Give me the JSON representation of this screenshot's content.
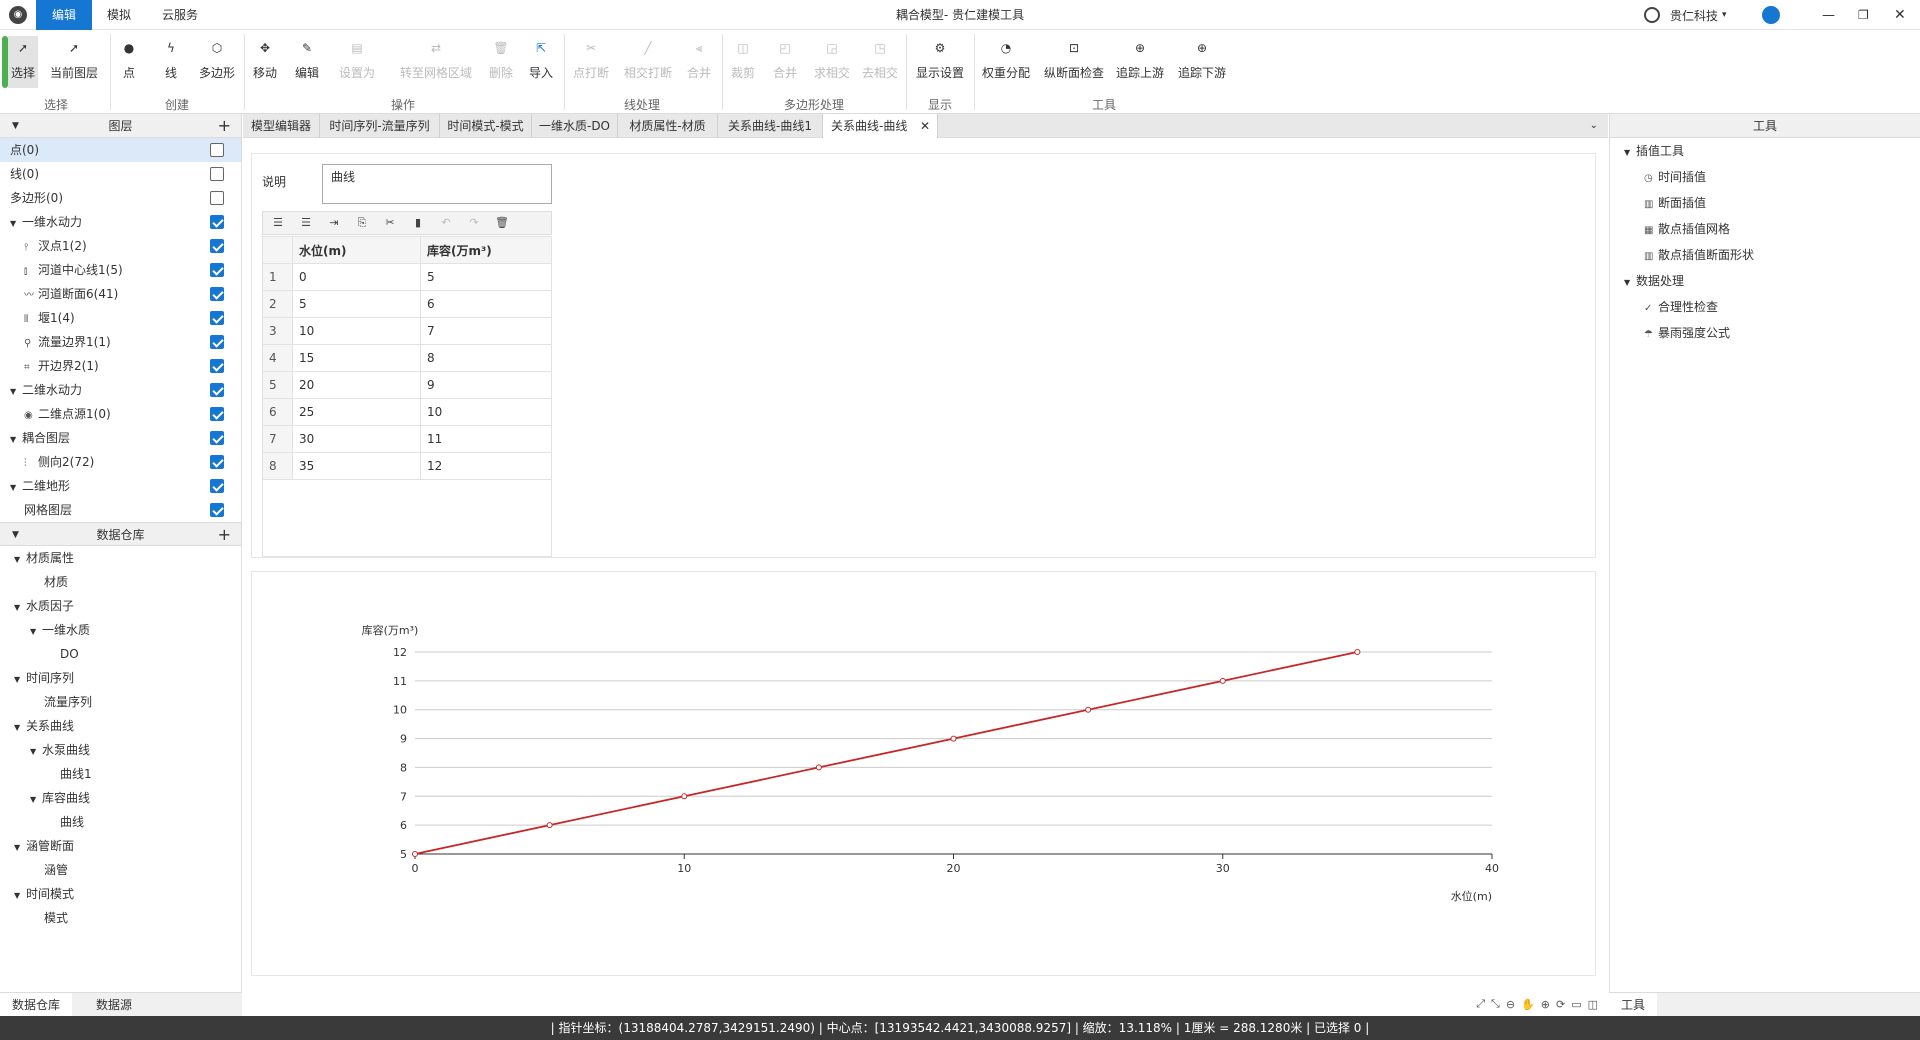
{
  "titlebar": {
    "app_title": "耦合模型- 贵仁建模工具",
    "menu_tabs": [
      "编辑",
      "模拟",
      "云服务"
    ],
    "company": "贵仁科技"
  },
  "ribbon": {
    "groups": [
      "选择",
      "创建",
      "操作",
      "线处理",
      "多边形处理",
      "显示",
      "工具"
    ],
    "buttons": {
      "select": "选择",
      "current_layer": "当前图层",
      "point": "点",
      "line": "线",
      "polygon": "多边形",
      "move": "移动",
      "edit": "编辑",
      "set_as": "设置为",
      "to_grid_area": "转至网格区域",
      "delete": "删除",
      "import": "导入",
      "point_break": "点打断",
      "intersect_break": "相交打断",
      "merge_line": "合并",
      "clip": "裁剪",
      "merge_poly": "合并",
      "intersect": "求相交",
      "remove_intersect": "去相交",
      "display_settings": "显示设置",
      "weight_dist": "权重分配",
      "profile_check": "纵断面检查",
      "trace_up": "追踪上游",
      "trace_down": "追踪下游"
    }
  },
  "layers": {
    "header": "图层",
    "items": [
      {
        "label": "点(0)",
        "checked": false
      },
      {
        "label": "线(0)",
        "checked": false
      },
      {
        "label": "多边形(0)",
        "checked": false
      },
      {
        "label": "一维水动力",
        "checked": true
      },
      {
        "label": "汊点1(2)",
        "checked": true
      },
      {
        "label": "河道中心线1(5)",
        "checked": true
      },
      {
        "label": "河道断面6(41)",
        "checked": true
      },
      {
        "label": "堰1(4)",
        "checked": true
      },
      {
        "label": "流量边界1(1)",
        "checked": true
      },
      {
        "label": "开边界2(1)",
        "checked": true
      },
      {
        "label": "二维水动力",
        "checked": true
      },
      {
        "label": "二维点源1(0)",
        "checked": true
      },
      {
        "label": "耦合图层",
        "checked": true
      },
      {
        "label": "侧向2(72)",
        "checked": true
      },
      {
        "label": "二维地形",
        "checked": true
      },
      {
        "label": "网格图层",
        "checked": true
      }
    ]
  },
  "warehouse": {
    "header": "数据仓库",
    "items": [
      "材质属性",
      "材质",
      "水质因子",
      "一维水质",
      "DO",
      "时间序列",
      "流量序列",
      "关系曲线",
      "水泵曲线",
      "曲线1",
      "库容曲线",
      "曲线",
      "涵管断面",
      "涵管",
      "时间模式",
      "模式"
    ]
  },
  "bottom_tabs": [
    "数据仓库",
    "数据源"
  ],
  "doc_tabs": [
    "模型编辑器",
    "时间序列-流量序列",
    "时间模式-模式",
    "一维水质-DO",
    "材质属性-材质",
    "关系曲线-曲线1",
    "关系曲线-曲线"
  ],
  "editor": {
    "desc_label": "说明",
    "desc_value": "曲线",
    "columns": [
      "水位(m)",
      "库容(万m³)"
    ],
    "rows": [
      [
        "1",
        "0",
        "5"
      ],
      [
        "2",
        "5",
        "6"
      ],
      [
        "3",
        "10",
        "7"
      ],
      [
        "4",
        "15",
        "8"
      ],
      [
        "5",
        "20",
        "9"
      ],
      [
        "6",
        "25",
        "10"
      ],
      [
        "7",
        "30",
        "11"
      ],
      [
        "8",
        "35",
        "12"
      ]
    ]
  },
  "chart_data": {
    "type": "line",
    "x": [
      0,
      5,
      10,
      15,
      20,
      25,
      30,
      35
    ],
    "series": [
      {
        "values": [
          5,
          6,
          7,
          8,
          9,
          10,
          11,
          12
        ],
        "color": "#c62828"
      }
    ],
    "xlabel": "水位(m)",
    "ylabel": "库容(万m³)",
    "xlim": [
      0,
      40
    ],
    "ylim": [
      5,
      12
    ],
    "xticks": [
      "0",
      "10",
      "20",
      "30",
      "40"
    ],
    "yticks": [
      "5",
      "6",
      "7",
      "8",
      "9",
      "10",
      "11",
      "12"
    ],
    "grid": true
  },
  "tools": {
    "header": "工具",
    "groups": [
      {
        "label": "插值工具",
        "items": [
          "时间插值",
          "断面插值",
          "散点插值网格",
          "散点插值断面形状"
        ]
      },
      {
        "label": "数据处理",
        "items": [
          "合理性检查",
          "暴雨强度公式"
        ]
      }
    ],
    "bottom_tab": "工具"
  },
  "status": "|  指针坐标：(13188404.2787,3429151.2490)   |  中心点：[13193542.4421,3430088.9257]   |  缩放：13.118%   |  1厘米 = 288.1280米   |  已选择 0   |"
}
